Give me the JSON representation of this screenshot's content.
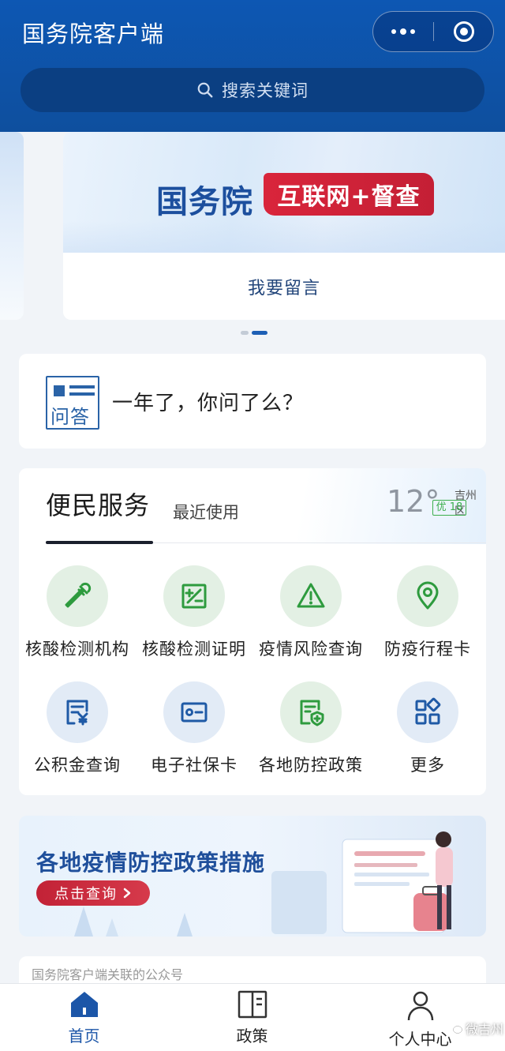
{
  "header": {
    "title": "国务院客户端",
    "search_placeholder": "搜索关键词"
  },
  "banner": {
    "main_text": "国务院",
    "tag_text": "互联网+督查",
    "link_text": "我要留言",
    "slides_total": 2,
    "active_slide": 2
  },
  "qa": {
    "icon_text": "问答",
    "text": "一年了，你问了么？"
  },
  "services": {
    "tab_active": "便民服务",
    "tab_recent": "最近使用",
    "weather": {
      "temp": "12°",
      "location": "吉州区",
      "aqi": "优 18"
    },
    "items": [
      {
        "label": "核酸检测机构",
        "icon": "dropper-icon"
      },
      {
        "label": "核酸检测证明",
        "icon": "certificate-icon"
      },
      {
        "label": "疫情风险查询",
        "icon": "warning-icon"
      },
      {
        "label": "防疫行程卡",
        "icon": "location-pin-icon"
      },
      {
        "label": "公积金查询",
        "icon": "fund-document-icon"
      },
      {
        "label": "电子社保卡",
        "icon": "id-card-icon"
      },
      {
        "label": "各地防控政策",
        "icon": "shield-document-icon"
      },
      {
        "label": "更多",
        "icon": "grid-more-icon"
      }
    ]
  },
  "policy_banner": {
    "title": "各地疫情防控政策措施",
    "button": "点击查询"
  },
  "gzh": {
    "text": "国务院客户端关联的公众号"
  },
  "nav": {
    "home": "首页",
    "policy": "政策",
    "profile": "个人中心"
  },
  "watermark": "微吉州",
  "colors": {
    "primary": "#0d57b3",
    "accent_red": "#c41f35",
    "green_icon": "#2e9b3e",
    "blue_icon": "#1f5aa6"
  }
}
